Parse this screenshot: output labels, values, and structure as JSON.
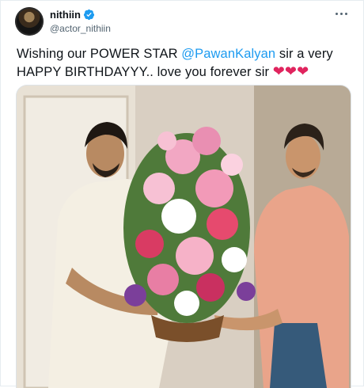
{
  "tweet": {
    "author": {
      "display_name": "nithiin",
      "handle": "@actor_nithiin",
      "verified": true
    },
    "text_before": "Wishing our POWER STAR ",
    "mention": "@PawanKalyan",
    "text_after": " sir a very HAPPY BIRTHDAYYY.. love you forever sir ",
    "hearts": "❤❤❤"
  },
  "icons": {
    "verified": "verified-badge-icon",
    "more": "more-options-icon"
  },
  "colors": {
    "accent": "#1d9bf0",
    "heart": "#e0245e",
    "handle": "#536471"
  }
}
